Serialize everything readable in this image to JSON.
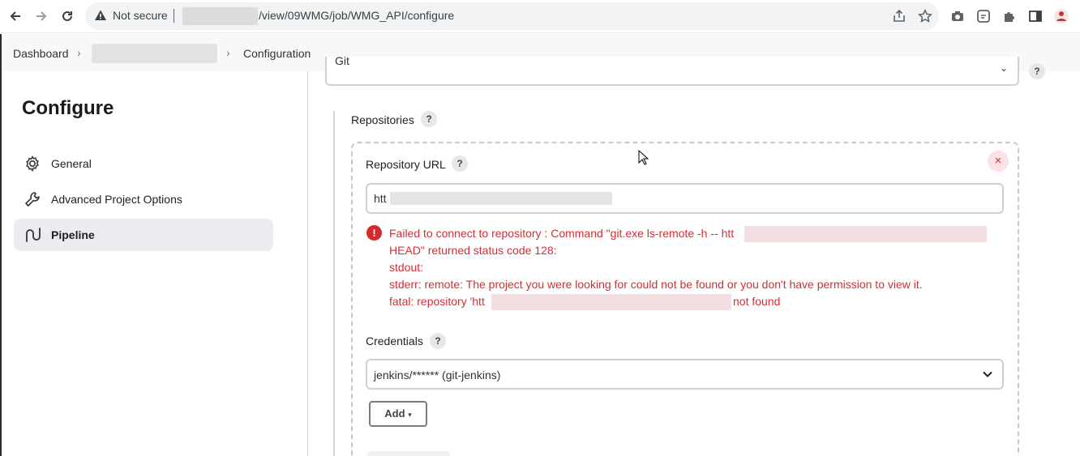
{
  "browser": {
    "security_label": "Not secure",
    "url_path": "/view/09WMG/job/WMG_API/configure"
  },
  "breadcrumb": {
    "dashboard": "Dashboard",
    "current": "Configuration"
  },
  "sidebar": {
    "title": "Configure",
    "items": [
      {
        "label": "General",
        "icon": "gear-icon"
      },
      {
        "label": "Advanced Project Options",
        "icon": "wrench-icon"
      },
      {
        "label": "Pipeline",
        "icon": "pipeline-icon",
        "active": true
      }
    ]
  },
  "scm": {
    "selected": "Git",
    "repositories_label": "Repositories",
    "repo_url_label": "Repository URL",
    "repo_url_value": "htt",
    "error_lines": [
      "Failed to connect to repository : Command \"git.exe ls-remote -h -- htt",
      "HEAD\" returned status code 128:",
      "stdout:",
      "stderr: remote: The project you were looking for could not be found or you don't have permission to view it.",
      "fatal: repository 'htt"
    ],
    "error_tail": "not found",
    "credentials_label": "Credentials",
    "credentials_value": "jenkins/****** (git-jenkins)",
    "add_label": "Add",
    "help_glyph": "?",
    "close_glyph": "×",
    "error_glyph": "!"
  },
  "colors": {
    "error": "#cf3036",
    "active_bg": "#ebebf0"
  }
}
